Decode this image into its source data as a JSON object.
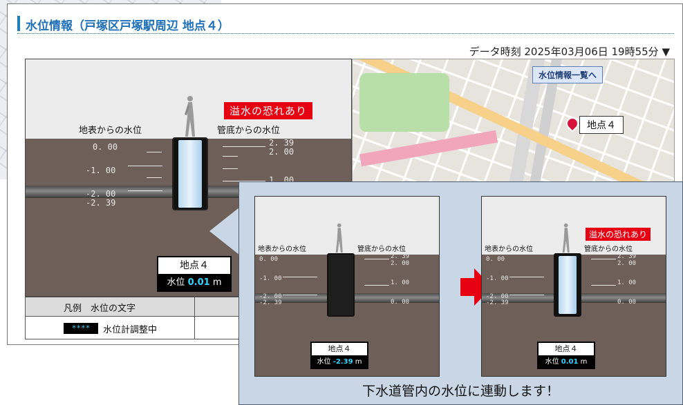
{
  "header": {
    "title": "水位情報（戸塚区戸塚駅周辺 地点４）"
  },
  "timestamp": "データ時刻 2025年03月06日 19時55分 ▼",
  "panel": {
    "alert": "溢水の恐れあり",
    "surface_label": "地表からの水位",
    "pipe_label": "管底からの水位",
    "surface_ticks": [
      "0. 00",
      "-1. 00",
      "-2. 00",
      "-2. 39"
    ],
    "pipe_ticks": [
      "2. 39",
      "2. 00",
      "1. 00"
    ],
    "station": "地点４",
    "level_label": "水位",
    "level_value": "0.01",
    "level_unit": "m"
  },
  "map": {
    "list_button": "水位情報一覧へ",
    "pin_label": "地点４"
  },
  "legend": {
    "header": "凡例　水位の文字",
    "swatch_text": "****",
    "swatch_label": "水位計調整中"
  },
  "comparison": {
    "before": {
      "surface_label": "地表からの水位",
      "pipe_label": "管底からの水位",
      "surface_ticks": [
        "0. 00",
        "-1. 00",
        "-2. 00",
        "-2. 39"
      ],
      "pipe_ticks": [
        "2. 39",
        "2. 00",
        "1. 00",
        "0. 00"
      ],
      "station": "地点４",
      "level_label": "水位",
      "level_value": "-2.39",
      "level_unit": "m"
    },
    "after": {
      "alert": "溢水の恐れあり",
      "surface_label": "地表からの水位",
      "pipe_label": "管底からの水位",
      "surface_ticks": [
        "0. 00",
        "-1. 00",
        "-2. 00",
        "-2. 39"
      ],
      "pipe_ticks": [
        "2. 39",
        "2. 00",
        "1. 00",
        "0. 00"
      ],
      "station": "地点４",
      "level_label": "水位",
      "level_value": "0.01",
      "level_unit": "m"
    },
    "caption": "下水道管内の水位に連動します！"
  },
  "colors": {
    "accent": "#1b7fc1",
    "alert": "#e60012",
    "level_text": "#35d4ff",
    "ground": "#6e6058"
  },
  "icons": [
    "person-icon",
    "map-pin-icon",
    "arrow-right-icon",
    "dropdown-triangle-icon"
  ]
}
